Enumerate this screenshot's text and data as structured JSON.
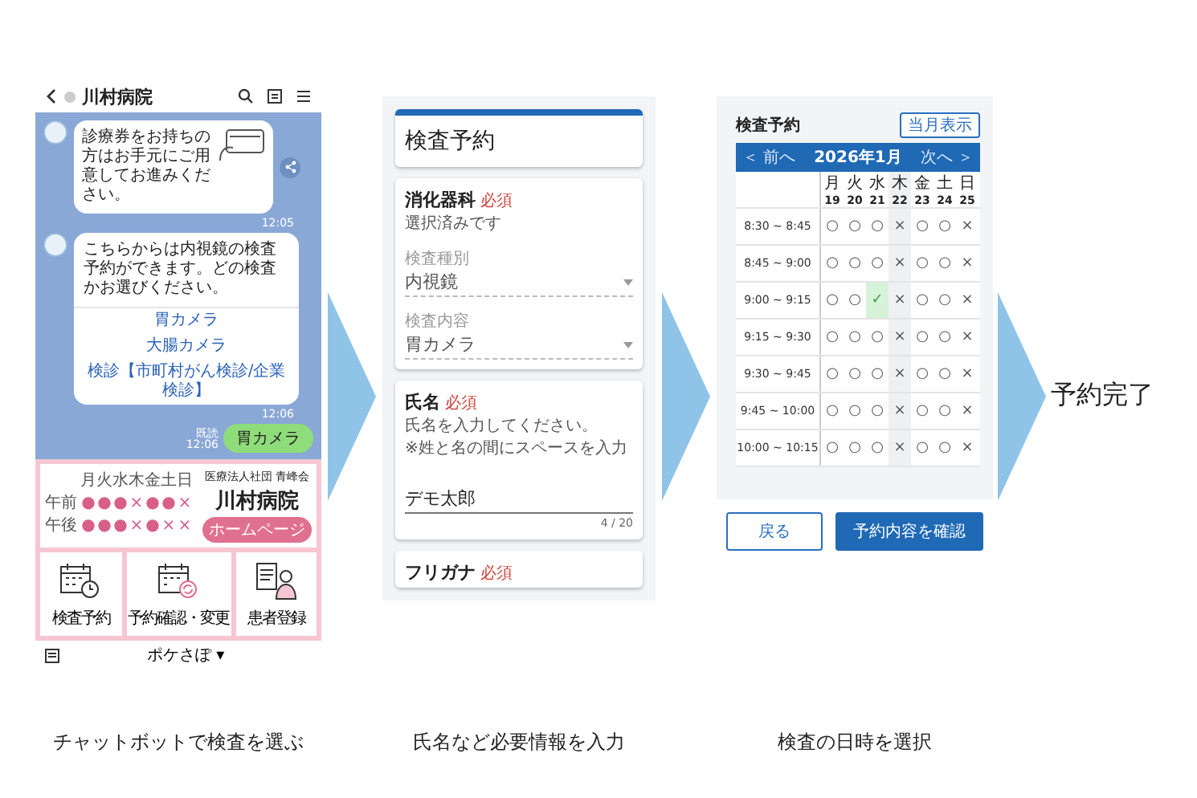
{
  "chat_screen": {
    "title": "川村病院",
    "message_1": {
      "text": "診療券をお持ちの方はお手元にご用意してお進みください。",
      "time": "12:05"
    },
    "message_2": {
      "text": "こちらからは内視鏡の検査予約ができます。どの検査かお選びください。",
      "options": [
        "胃カメラ",
        "大腸カメラ",
        "検診【市町村がん検診/企業検診】"
      ],
      "time": "12:06"
    },
    "reply": {
      "text": "胃カメラ",
      "read": "既読",
      "time": "12:06"
    },
    "menu": {
      "schedule": {
        "days": [
          "月",
          "火",
          "水",
          "木",
          "金",
          "土",
          "日"
        ],
        "rows": [
          {
            "label": "午前",
            "marks": [
              "●",
              "●",
              "●",
              "×",
              "●",
              "●",
              "×"
            ]
          },
          {
            "label": "午後",
            "marks": [
              "●",
              "●",
              "●",
              "×",
              "●",
              "×",
              "×"
            ]
          }
        ]
      },
      "org": "医療法人社団 青峰会",
      "name": "川村病院",
      "homepage": "ホームページ",
      "tiles": [
        {
          "label": "検査予約",
          "kind": "calendar-clock"
        },
        {
          "label": "予約確認・変更",
          "kind": "calendar-refresh"
        },
        {
          "label": "患者登録",
          "kind": "person-form"
        }
      ]
    },
    "footer": "ポケさぽ ▾"
  },
  "form_screen": {
    "title": "検査予約",
    "department": {
      "label": "消化器科",
      "required": "必須",
      "note": "選択済みです",
      "selects": [
        {
          "label": "検査種別",
          "value": "内視鏡"
        },
        {
          "label": "検査内容",
          "value": "胃カメラ"
        }
      ]
    },
    "name_field": {
      "label": "氏名",
      "required": "必須",
      "hint": "氏名を入力してください。",
      "note": "※姓と名の間にスペースを入力",
      "value": "デモ太郎",
      "counter": "4 / 20"
    },
    "next_field": {
      "label": "フリガナ",
      "required": "必須"
    }
  },
  "calendar_screen": {
    "title": "検査予約",
    "current_button": "当月表示",
    "prev": "＜ 前へ",
    "month": "2026年1月",
    "next": "次へ ＞",
    "columns": [
      {
        "day": "月",
        "date": "19",
        "closed": false
      },
      {
        "day": "火",
        "date": "20",
        "closed": false
      },
      {
        "day": "水",
        "date": "21",
        "closed": false
      },
      {
        "day": "木",
        "date": "22",
        "closed": true
      },
      {
        "day": "金",
        "date": "23",
        "closed": false
      },
      {
        "day": "土",
        "date": "24",
        "closed": false
      },
      {
        "day": "日",
        "date": "25",
        "closed": false
      }
    ],
    "rows": [
      {
        "time": "8:30 ~ 8:45",
        "cells": [
          {
            "mark": "○",
            "selected": false
          },
          {
            "mark": "○",
            "selected": false
          },
          {
            "mark": "○",
            "selected": false
          },
          {
            "mark": "×",
            "selected": false
          },
          {
            "mark": "○",
            "selected": false
          },
          {
            "mark": "○",
            "selected": false
          },
          {
            "mark": "×",
            "selected": false
          }
        ]
      },
      {
        "time": "8:45 ~ 9:00",
        "cells": [
          {
            "mark": "○",
            "selected": false
          },
          {
            "mark": "○",
            "selected": false
          },
          {
            "mark": "○",
            "selected": false
          },
          {
            "mark": "×",
            "selected": false
          },
          {
            "mark": "○",
            "selected": false
          },
          {
            "mark": "○",
            "selected": false
          },
          {
            "mark": "×",
            "selected": false
          }
        ]
      },
      {
        "time": "9:00 ~ 9:15",
        "cells": [
          {
            "mark": "○",
            "selected": false
          },
          {
            "mark": "○",
            "selected": false
          },
          {
            "mark": "✓",
            "selected": true
          },
          {
            "mark": "×",
            "selected": false
          },
          {
            "mark": "○",
            "selected": false
          },
          {
            "mark": "○",
            "selected": false
          },
          {
            "mark": "×",
            "selected": false
          }
        ]
      },
      {
        "time": "9:15 ~ 9:30",
        "cells": [
          {
            "mark": "○",
            "selected": false
          },
          {
            "mark": "○",
            "selected": false
          },
          {
            "mark": "○",
            "selected": false
          },
          {
            "mark": "×",
            "selected": false
          },
          {
            "mark": "○",
            "selected": false
          },
          {
            "mark": "○",
            "selected": false
          },
          {
            "mark": "×",
            "selected": false
          }
        ]
      },
      {
        "time": "9:30 ~ 9:45",
        "cells": [
          {
            "mark": "○",
            "selected": false
          },
          {
            "mark": "○",
            "selected": false
          },
          {
            "mark": "○",
            "selected": false
          },
          {
            "mark": "×",
            "selected": false
          },
          {
            "mark": "○",
            "selected": false
          },
          {
            "mark": "○",
            "selected": false
          },
          {
            "mark": "×",
            "selected": false
          }
        ]
      },
      {
        "time": "9:45 ~ 10:00",
        "cells": [
          {
            "mark": "○",
            "selected": false
          },
          {
            "mark": "○",
            "selected": false
          },
          {
            "mark": "○",
            "selected": false
          },
          {
            "mark": "×",
            "selected": false
          },
          {
            "mark": "○",
            "selected": false
          },
          {
            "mark": "○",
            "selected": false
          },
          {
            "mark": "×",
            "selected": false
          }
        ]
      },
      {
        "time": "10:00 ~ 10:15",
        "cells": [
          {
            "mark": "○",
            "selected": false
          },
          {
            "mark": "○",
            "selected": false
          },
          {
            "mark": "○",
            "selected": false
          },
          {
            "mark": "×",
            "selected": false
          },
          {
            "mark": "○",
            "selected": false
          },
          {
            "mark": "○",
            "selected": false
          },
          {
            "mark": "×",
            "selected": false
          }
        ]
      }
    ],
    "buttons": [
      "戻る",
      "予約内容を確認"
    ]
  },
  "captions": [
    "チャットボットで検査を選ぶ",
    "氏名など必要情報を入力",
    "検査の日時を選択"
  ],
  "final_step": "予約完了"
}
